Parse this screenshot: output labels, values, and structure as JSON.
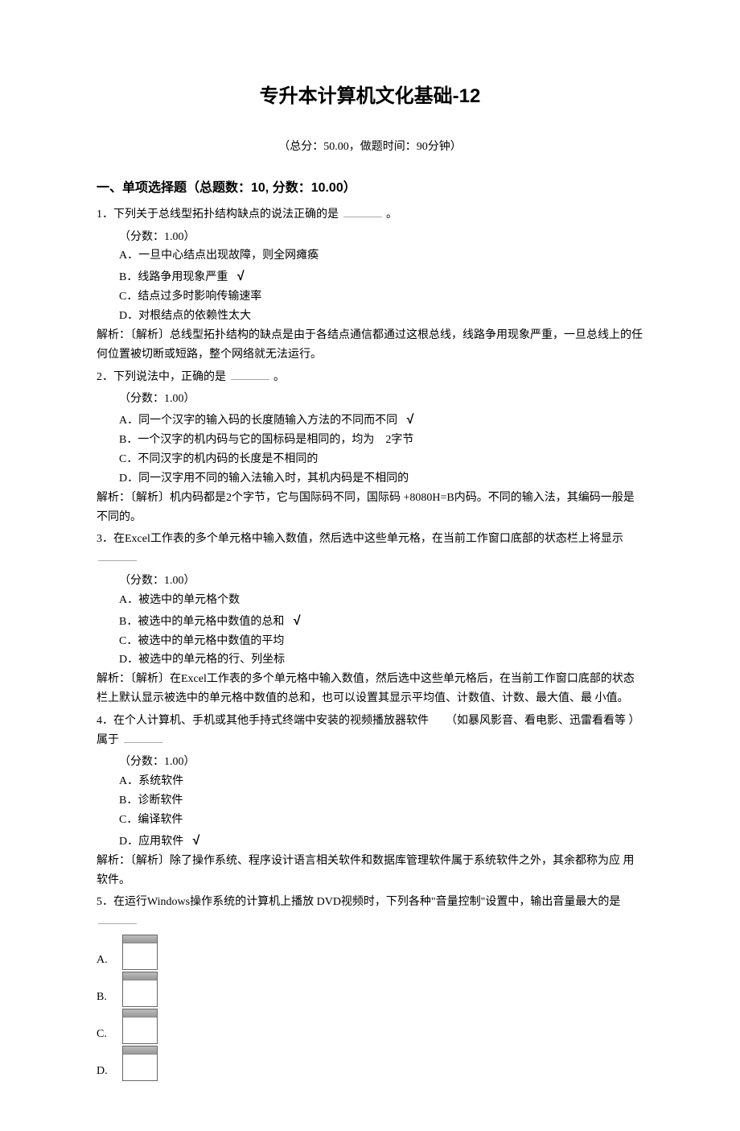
{
  "title": "专升本计算机文化基础-12",
  "meta": "（总分：50.00，做题时间：90分钟）",
  "section1": {
    "heading": "一、单项选择题（总题数：10, 分数：10.00）",
    "q1": {
      "stem_a": "1．下列关于总线型拓扑结构缺点的说法正确的是",
      "stem_b": "。",
      "score": "（分数：1.00）",
      "optA": "A．一旦中心结点出现故障，则全网瘫痪",
      "optB": "B．线路争用现象严重",
      "optC": "C．结点过多时影响传输速率",
      "optD": "D．对根结点的依赖性太大",
      "exp": "解析：〔解析〕总线型拓扑结构的缺点是由于各结点通信都通过这根总线，线路争用现象严重，一旦总线上的任何位置被切断或短路，整个网络就无法运行。"
    },
    "q2": {
      "stem_a": "2．下列说法中，正确的是",
      "stem_b": "。",
      "score": "（分数：1.00）",
      "optA": "A．同一个汉字的输入码的长度随输入方法的不同而不同",
      "optB": "B．一个汉字的机内码与它的国标码是相同的，均为　2字节",
      "optC": "C．不同汉字的机内码的长度是不相同的",
      "optD": "D．同一汉字用不同的输入法输入时，其机内码是不相同的",
      "exp": "解析：〔解析〕机内码都是2个字节，它与国际码不同，国际码 +8080H=B内码。不同的输入法，其编码一般是不同的。"
    },
    "q3": {
      "stem_a": "3．在Excel工作表的多个单元格中输入数值，然后选中这些单元格，在当前工作窗口底部的状态栏上将显示",
      "score": "（分数：1.00）",
      "optA": "A．被选中的单元格个数",
      "optB": "B．被选中的单元格中数值的总和",
      "optC": "C．被选中的单元格中数值的平均",
      "optD": "D．被选中的单元格的行、列坐标",
      "exp": "解析：〔解析〕在Excel工作表的多个单元格中输入数值，然后选中这些单元格后，在当前工作窗口底部的状态栏上默认显示被选中的单元格中数值的总和，也可以设置其显示平均值、计数值、计数、最大值、最 小值。"
    },
    "q4": {
      "stem_a": "4．在个人计算机、手机或其他手持式终端中安装的视频播放器软件　　（如暴风影音、看电影、迅雷看看等  ）属于",
      "score": "（分数：1.00）",
      "optA": "A．系统软件",
      "optB": "B．诊断软件",
      "optC": "C．编译软件",
      "optD": "D．应用软件",
      "exp": "解析：〔解析〕除了操作系统、程序设计语言相关软件和数据库管理软件属于系统软件之外，其余都称为应 用软件。"
    },
    "q5": {
      "stem_a": "5．在运行Windows操作系统的计算机上播放  DVD视频时，下列各种\"音量控制\"设置中，输出音量最大的是",
      "optA": "A.",
      "optB": "B.",
      "optC": "C.",
      "optD": "D."
    }
  },
  "check": "√"
}
